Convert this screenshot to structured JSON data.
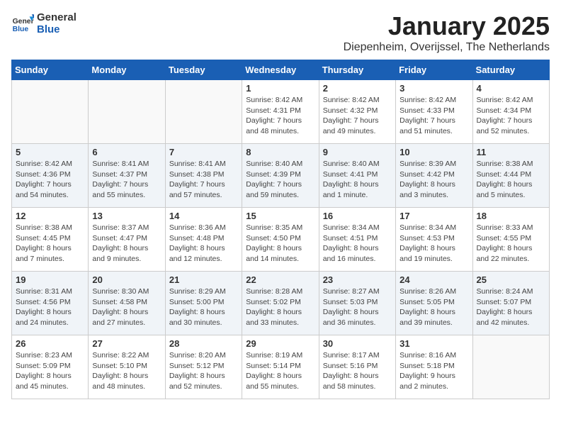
{
  "logo": {
    "line1": "General",
    "line2": "Blue"
  },
  "title": "January 2025",
  "location": "Diepenheim, Overijssel, The Netherlands",
  "weekdays": [
    "Sunday",
    "Monday",
    "Tuesday",
    "Wednesday",
    "Thursday",
    "Friday",
    "Saturday"
  ],
  "weeks": [
    [
      {
        "day": "",
        "info": ""
      },
      {
        "day": "",
        "info": ""
      },
      {
        "day": "",
        "info": ""
      },
      {
        "day": "1",
        "info": "Sunrise: 8:42 AM\nSunset: 4:31 PM\nDaylight: 7 hours\nand 48 minutes."
      },
      {
        "day": "2",
        "info": "Sunrise: 8:42 AM\nSunset: 4:32 PM\nDaylight: 7 hours\nand 49 minutes."
      },
      {
        "day": "3",
        "info": "Sunrise: 8:42 AM\nSunset: 4:33 PM\nDaylight: 7 hours\nand 51 minutes."
      },
      {
        "day": "4",
        "info": "Sunrise: 8:42 AM\nSunset: 4:34 PM\nDaylight: 7 hours\nand 52 minutes."
      }
    ],
    [
      {
        "day": "5",
        "info": "Sunrise: 8:42 AM\nSunset: 4:36 PM\nDaylight: 7 hours\nand 54 minutes."
      },
      {
        "day": "6",
        "info": "Sunrise: 8:41 AM\nSunset: 4:37 PM\nDaylight: 7 hours\nand 55 minutes."
      },
      {
        "day": "7",
        "info": "Sunrise: 8:41 AM\nSunset: 4:38 PM\nDaylight: 7 hours\nand 57 minutes."
      },
      {
        "day": "8",
        "info": "Sunrise: 8:40 AM\nSunset: 4:39 PM\nDaylight: 7 hours\nand 59 minutes."
      },
      {
        "day": "9",
        "info": "Sunrise: 8:40 AM\nSunset: 4:41 PM\nDaylight: 8 hours\nand 1 minute."
      },
      {
        "day": "10",
        "info": "Sunrise: 8:39 AM\nSunset: 4:42 PM\nDaylight: 8 hours\nand 3 minutes."
      },
      {
        "day": "11",
        "info": "Sunrise: 8:38 AM\nSunset: 4:44 PM\nDaylight: 8 hours\nand 5 minutes."
      }
    ],
    [
      {
        "day": "12",
        "info": "Sunrise: 8:38 AM\nSunset: 4:45 PM\nDaylight: 8 hours\nand 7 minutes."
      },
      {
        "day": "13",
        "info": "Sunrise: 8:37 AM\nSunset: 4:47 PM\nDaylight: 8 hours\nand 9 minutes."
      },
      {
        "day": "14",
        "info": "Sunrise: 8:36 AM\nSunset: 4:48 PM\nDaylight: 8 hours\nand 12 minutes."
      },
      {
        "day": "15",
        "info": "Sunrise: 8:35 AM\nSunset: 4:50 PM\nDaylight: 8 hours\nand 14 minutes."
      },
      {
        "day": "16",
        "info": "Sunrise: 8:34 AM\nSunset: 4:51 PM\nDaylight: 8 hours\nand 16 minutes."
      },
      {
        "day": "17",
        "info": "Sunrise: 8:34 AM\nSunset: 4:53 PM\nDaylight: 8 hours\nand 19 minutes."
      },
      {
        "day": "18",
        "info": "Sunrise: 8:33 AM\nSunset: 4:55 PM\nDaylight: 8 hours\nand 22 minutes."
      }
    ],
    [
      {
        "day": "19",
        "info": "Sunrise: 8:31 AM\nSunset: 4:56 PM\nDaylight: 8 hours\nand 24 minutes."
      },
      {
        "day": "20",
        "info": "Sunrise: 8:30 AM\nSunset: 4:58 PM\nDaylight: 8 hours\nand 27 minutes."
      },
      {
        "day": "21",
        "info": "Sunrise: 8:29 AM\nSunset: 5:00 PM\nDaylight: 8 hours\nand 30 minutes."
      },
      {
        "day": "22",
        "info": "Sunrise: 8:28 AM\nSunset: 5:02 PM\nDaylight: 8 hours\nand 33 minutes."
      },
      {
        "day": "23",
        "info": "Sunrise: 8:27 AM\nSunset: 5:03 PM\nDaylight: 8 hours\nand 36 minutes."
      },
      {
        "day": "24",
        "info": "Sunrise: 8:26 AM\nSunset: 5:05 PM\nDaylight: 8 hours\nand 39 minutes."
      },
      {
        "day": "25",
        "info": "Sunrise: 8:24 AM\nSunset: 5:07 PM\nDaylight: 8 hours\nand 42 minutes."
      }
    ],
    [
      {
        "day": "26",
        "info": "Sunrise: 8:23 AM\nSunset: 5:09 PM\nDaylight: 8 hours\nand 45 minutes."
      },
      {
        "day": "27",
        "info": "Sunrise: 8:22 AM\nSunset: 5:10 PM\nDaylight: 8 hours\nand 48 minutes."
      },
      {
        "day": "28",
        "info": "Sunrise: 8:20 AM\nSunset: 5:12 PM\nDaylight: 8 hours\nand 52 minutes."
      },
      {
        "day": "29",
        "info": "Sunrise: 8:19 AM\nSunset: 5:14 PM\nDaylight: 8 hours\nand 55 minutes."
      },
      {
        "day": "30",
        "info": "Sunrise: 8:17 AM\nSunset: 5:16 PM\nDaylight: 8 hours\nand 58 minutes."
      },
      {
        "day": "31",
        "info": "Sunrise: 8:16 AM\nSunset: 5:18 PM\nDaylight: 9 hours\nand 2 minutes."
      },
      {
        "day": "",
        "info": ""
      }
    ]
  ]
}
